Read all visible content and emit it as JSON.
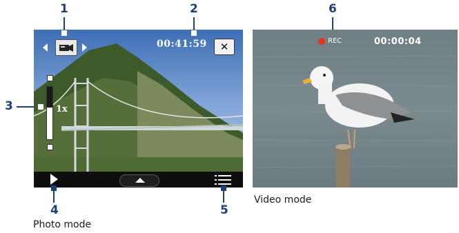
{
  "callouts": {
    "c1": "1",
    "c2": "2",
    "c3": "3",
    "c4": "4",
    "c5": "5",
    "c6": "6"
  },
  "photo_screen": {
    "timer": "00:41:59",
    "close_label": "✕",
    "zoom_level": "1x",
    "zoom_fraction": 0.4
  },
  "video_screen": {
    "rec_label": "REC",
    "timer": "00:00:04"
  },
  "captions": {
    "photo": "Photo mode",
    "video": "Video mode"
  },
  "icons": {
    "left": "arrow-left-icon",
    "right": "arrow-right-icon",
    "camera": "camcorder-icon",
    "close": "close-icon",
    "play": "play-icon",
    "up": "up-arrow-icon",
    "menu": "menu-icon",
    "rec": "record-dot-icon"
  },
  "colors": {
    "callout": "#1d3f7a",
    "rec": "#e8321a"
  }
}
